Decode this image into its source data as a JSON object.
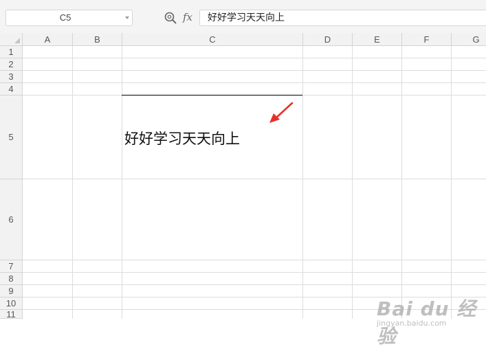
{
  "formula_bar": {
    "name_box": "C5",
    "fx_label": "fx",
    "formula_value": "好好学习天天向上"
  },
  "grid": {
    "columns": [
      "A",
      "B",
      "C",
      "D",
      "E",
      "F",
      "G"
    ],
    "rows": [
      "1",
      "2",
      "3",
      "4",
      "5",
      "6",
      "7",
      "8",
      "9",
      "10",
      "11"
    ],
    "active_cell": "C5",
    "cell_c5_value": "好好学习天天向上"
  },
  "colors": {
    "header_bg": "#f2f2f2",
    "grid_line": "#dcdcdc",
    "arrow": "#e8302a"
  },
  "icons": {
    "zoom": "zoom-icon",
    "fx": "fx-icon",
    "dropdown": "chevron-down-icon",
    "arrow": "red-arrow-icon"
  },
  "watermark": {
    "logo": "Bai du 经验",
    "sub": "jingyan.baidu.com"
  }
}
